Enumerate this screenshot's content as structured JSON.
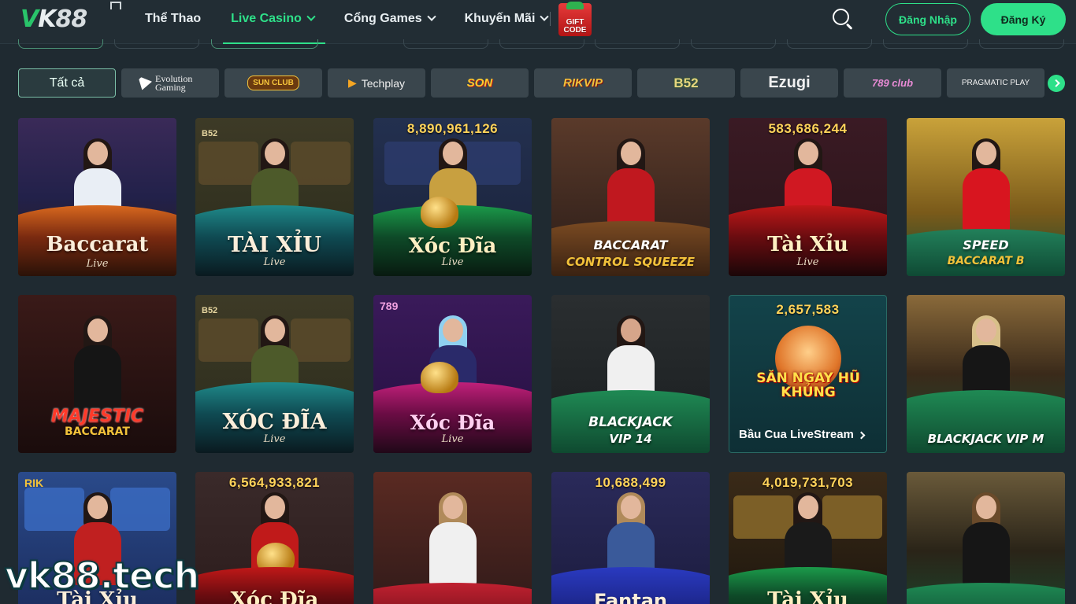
{
  "header": {
    "logo_text": "VK88",
    "nav": [
      {
        "label": "Thể Thao",
        "has_dropdown": false,
        "active": false
      },
      {
        "label": "Live Casino",
        "has_dropdown": true,
        "active": true
      },
      {
        "label": "Cổng Games",
        "has_dropdown": true,
        "active": false
      },
      {
        "label": "Khuyến Mãi",
        "has_dropdown": true,
        "active": false
      }
    ],
    "gift_code": {
      "line1": "GIFT",
      "line2": "CODE"
    },
    "search_icon": "search-icon",
    "login_label": "Đăng Nhập",
    "register_label": "Đăng Ký"
  },
  "colors": {
    "accent": "#2ee089",
    "background": "#1f2a31",
    "header_bg": "#222d34",
    "provider_bg": "#3a464d",
    "jackpot": "#ffd35a"
  },
  "providers": [
    {
      "label": "Tất cả",
      "active": true
    },
    {
      "label": "Evolution Gaming"
    },
    {
      "label": "SUN CLUB"
    },
    {
      "label": "Techplay"
    },
    {
      "label": "SON"
    },
    {
      "label": "RIKVIP"
    },
    {
      "label": "B52"
    },
    {
      "label": "Ezugi"
    },
    {
      "label": "789 club"
    },
    {
      "label": "PRAGMATIC PLAY"
    }
  ],
  "games": [
    {
      "title": "Baccarat",
      "subtitle": "Live"
    },
    {
      "title": "TÀI XỈU",
      "subtitle": "Live",
      "provider_badge": "B52"
    },
    {
      "title": "Xóc Đĩa",
      "subtitle": "Live",
      "jackpot": "8,890,961,126"
    },
    {
      "title": "BACCARAT",
      "subtitle": "CONTROL SQUEEZE"
    },
    {
      "title": "Tài Xỉu",
      "subtitle": "Live",
      "jackpot": "583,686,244"
    },
    {
      "title": "SPEED",
      "subtitle": "BACCARAT B"
    },
    {
      "title": "MAJESTIC",
      "subtitle": "BACCARAT"
    },
    {
      "title": "XÓC ĐĨA",
      "subtitle": "Live",
      "provider_badge": "B52"
    },
    {
      "title": "Xóc Đĩa",
      "subtitle": "Live",
      "provider_badge": "789"
    },
    {
      "title": "BLACKJACK",
      "subtitle": "VIP 14"
    },
    {
      "title": "SĂN NGAY HŨ KHỦNG",
      "jackpot": "2,657,583",
      "link_label": "Bầu Cua LiveStream"
    },
    {
      "title": "BLACKJACK VIP M"
    },
    {
      "title": "Tài Xỉu",
      "provider_badge": "RIK"
    },
    {
      "title": "Xóc Đĩa",
      "jackpot": "6,564,933,821"
    },
    {
      "title": ""
    },
    {
      "title": "Fantan",
      "jackpot": "10,688,499"
    },
    {
      "title": "Tài Xỉu",
      "jackpot": "4,019,731,703"
    },
    {
      "title": ""
    }
  ],
  "watermark": "vk88.tech"
}
